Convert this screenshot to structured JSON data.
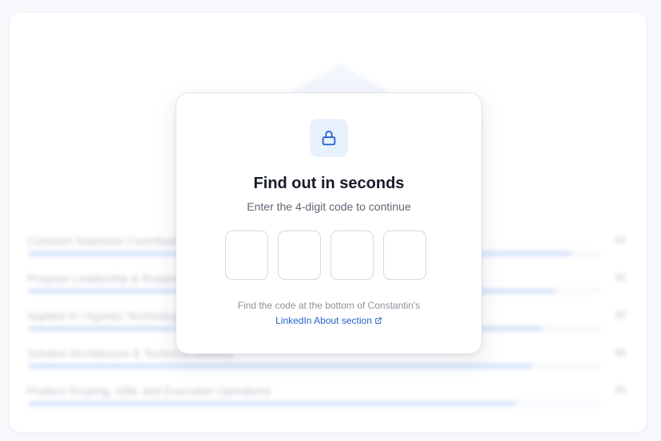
{
  "background_rows": [
    {
      "label": "Constant Stephanic Contribution",
      "value": "94",
      "fill_fraction": 0.95
    },
    {
      "label": "Program Leadership & Roadmap",
      "value": "92",
      "fill_fraction": 0.92
    },
    {
      "label": "Applied AI / Agentic Technology",
      "value": "90",
      "fill_fraction": 0.9
    },
    {
      "label": "Solution Architecture & Technical Delivery",
      "value": "88",
      "fill_fraction": 0.88
    },
    {
      "label": "Product Scoping, GtM, and Execution Operations",
      "value": "85",
      "fill_fraction": 0.85
    }
  ],
  "modal": {
    "icon": "lock-icon",
    "title": "Find out in seconds",
    "subtitle": "Enter the 4-digit code to continue",
    "hint_text": "Find the code at the bottom of Constantin's",
    "link_text": "LinkedIn About section",
    "link_icon": "external-link-icon"
  },
  "colors": {
    "accent": "#2463c8",
    "badge_bg": "#e9f1fd",
    "bar_fill": "#bcd2f5"
  }
}
